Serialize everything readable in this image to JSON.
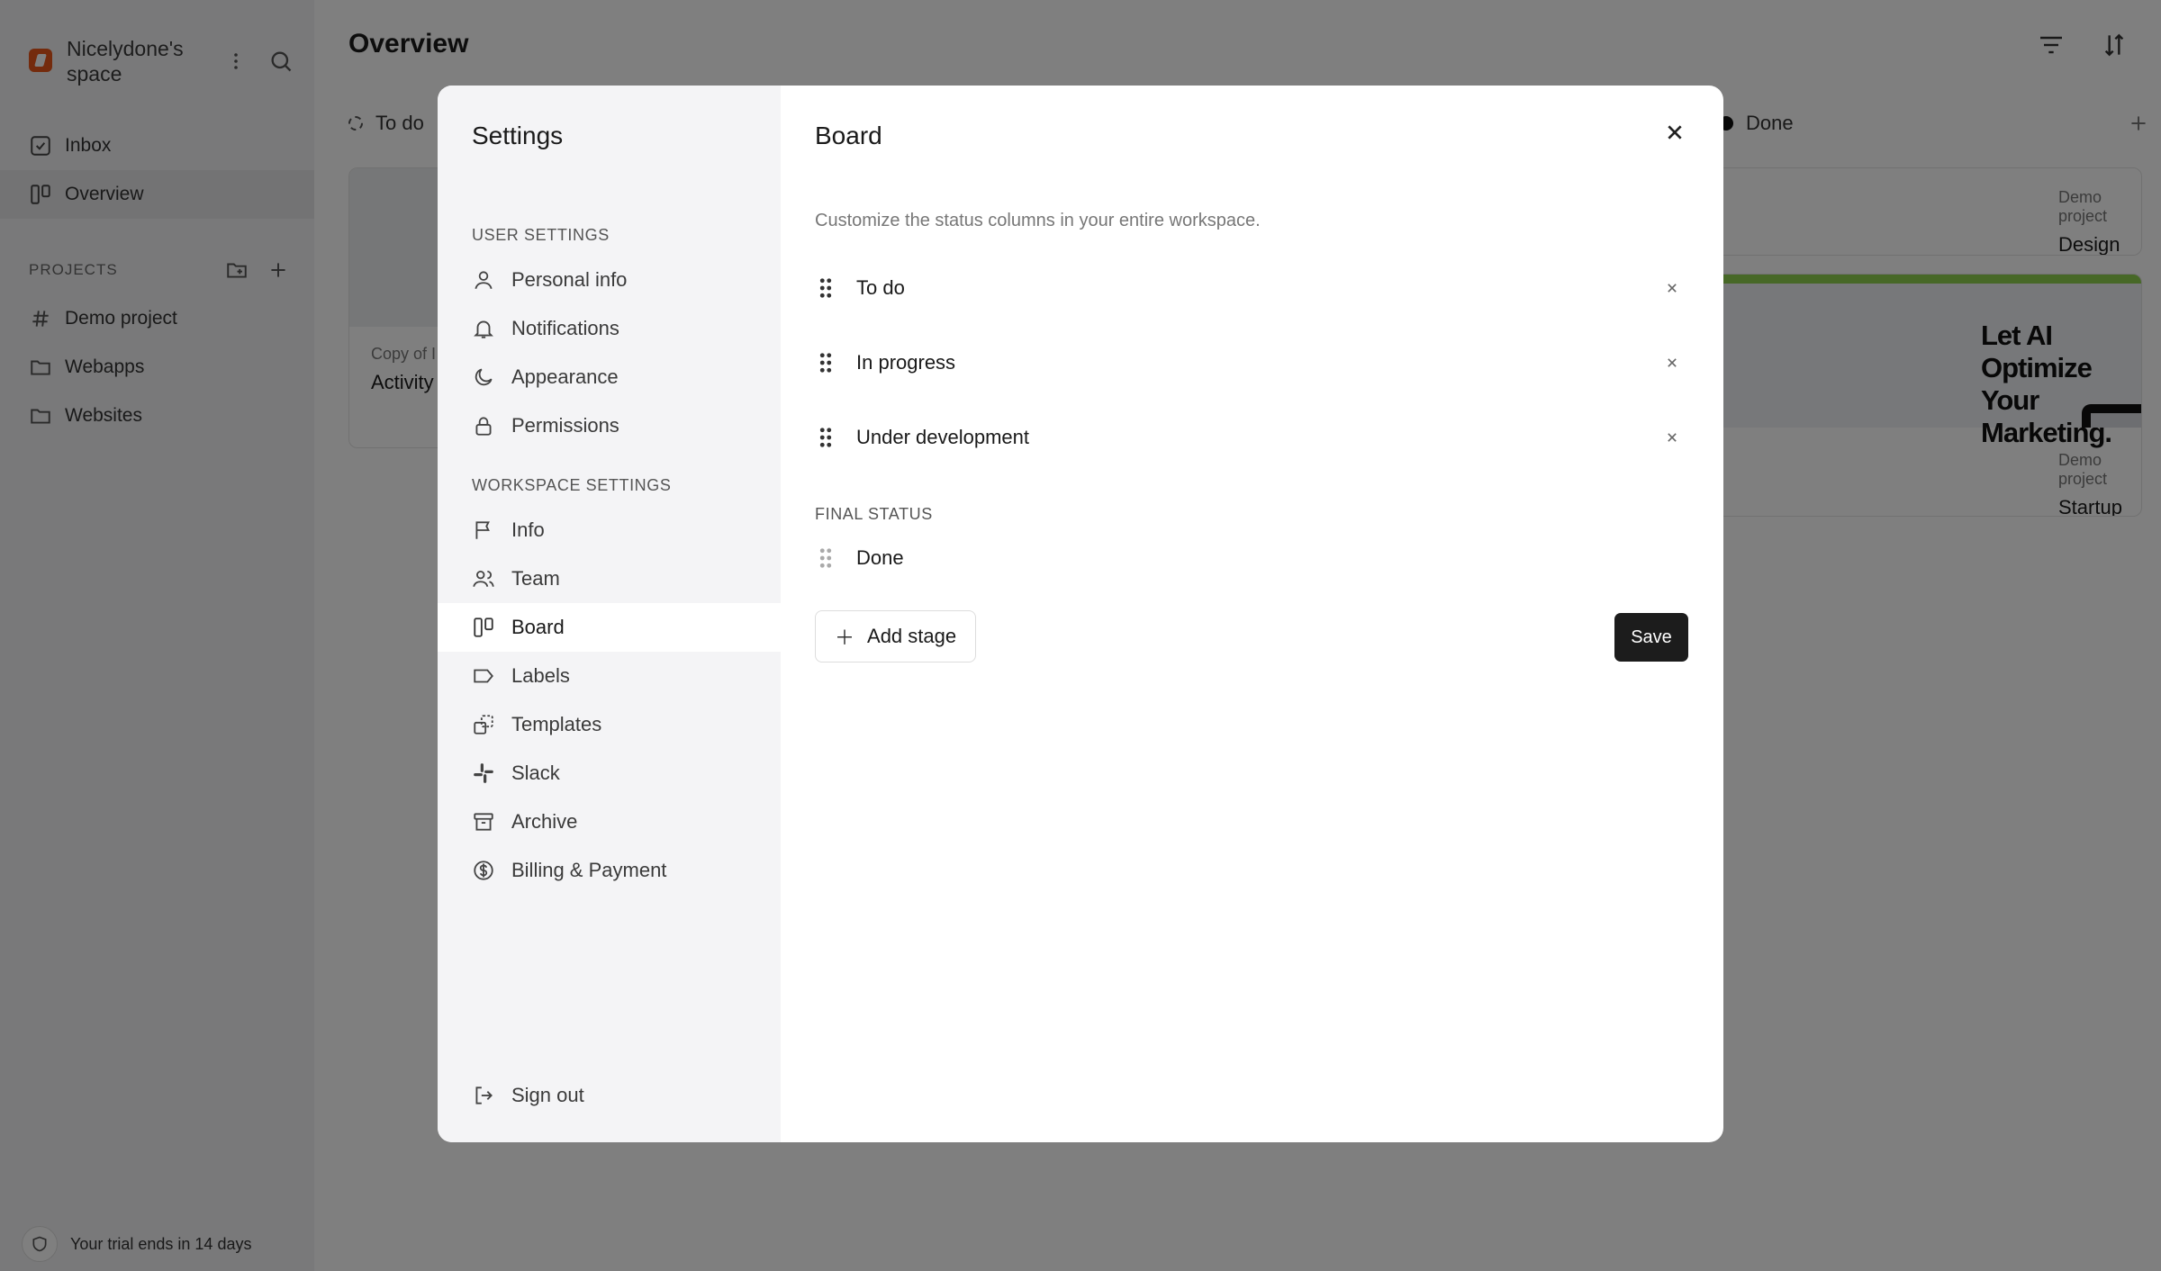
{
  "workspace": {
    "name": "Nicelydone's space"
  },
  "sidebar": {
    "nav": [
      {
        "label": "Inbox"
      },
      {
        "label": "Overview"
      }
    ],
    "projects_heading": "PROJECTS",
    "projects": [
      {
        "label": "Demo project"
      },
      {
        "label": "Webapps"
      },
      {
        "label": "Websites"
      }
    ],
    "trial": "Your trial ends in 14 days"
  },
  "main": {
    "title": "Overview",
    "columns": [
      {
        "label": "To do"
      },
      {
        "label": "Done"
      }
    ],
    "cards": [
      {
        "project": "Copy of I",
        "title": "Activity"
      },
      {
        "project": "Demo project",
        "title": "Design email newsletter template"
      },
      {
        "project": "Demo project",
        "title": "Startup landing page update",
        "thumb_headline": "Let AI Optimize Your Marketing."
      }
    ]
  },
  "settings": {
    "title": "Settings",
    "user_section": "USER SETTINGS",
    "user_items": [
      {
        "label": "Personal info",
        "icon": "user-icon"
      },
      {
        "label": "Notifications",
        "icon": "bell-icon"
      },
      {
        "label": "Appearance",
        "icon": "moon-icon"
      },
      {
        "label": "Permissions",
        "icon": "lock-icon"
      }
    ],
    "workspace_section": "WORKSPACE SETTINGS",
    "workspace_items": [
      {
        "label": "Info",
        "icon": "flag-icon"
      },
      {
        "label": "Team",
        "icon": "users-icon"
      },
      {
        "label": "Board",
        "icon": "board-icon",
        "active": true
      },
      {
        "label": "Labels",
        "icon": "tag-icon"
      },
      {
        "label": "Templates",
        "icon": "templates-icon"
      },
      {
        "label": "Slack",
        "icon": "slack-icon"
      },
      {
        "label": "Archive",
        "icon": "archive-icon"
      },
      {
        "label": "Billing & Payment",
        "icon": "dollar-icon"
      }
    ],
    "sign_out": "Sign out"
  },
  "board": {
    "title": "Board",
    "description": "Customize the status columns in your entire workspace.",
    "stages": [
      {
        "label": "To do"
      },
      {
        "label": "In progress"
      },
      {
        "label": "Under development"
      }
    ],
    "final_label": "FINAL STATUS",
    "final_stage": "Done",
    "add_stage": "Add stage",
    "save": "Save"
  },
  "colors": {
    "accent": "#e8571b",
    "save_bg": "#1c1c1c",
    "overlay": "rgba(0,0,0,0.5)"
  }
}
